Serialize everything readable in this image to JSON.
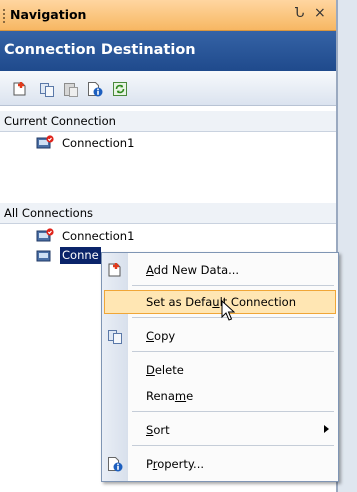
{
  "pane": {
    "title": "Navigation",
    "pin_glyph": "Ն",
    "close_glyph": "×",
    "header": "Connection Destination"
  },
  "toolbar": {
    "icons": [
      "new-connection-icon",
      "copy-icon",
      "paste-icon",
      "property-icon",
      "refresh-icon"
    ]
  },
  "current_section": {
    "label": "Current Connection",
    "items": [
      "Connection1"
    ]
  },
  "all_section": {
    "label": "All Connections",
    "items": [
      "Connection1",
      "Conne"
    ]
  },
  "context_menu": {
    "add_new_data": {
      "pre": "",
      "key": "A",
      "post": "dd New Data..."
    },
    "set_default": {
      "pre": "Set as Defa",
      "key": "u",
      "post": "lt Connection"
    },
    "copy": {
      "pre": "",
      "key": "C",
      "post": "opy"
    },
    "delete": {
      "pre": "",
      "key": "D",
      "post": "elete"
    },
    "rename": {
      "pre": "Rena",
      "key": "m",
      "post": "e"
    },
    "sort": {
      "pre": "",
      "key": "S",
      "post": "ort"
    },
    "property": {
      "pre": "P",
      "key": "r",
      "post": "operty..."
    }
  },
  "colors": {
    "title_bar": "#f7b763",
    "header_blue": "#1f4a8c",
    "menu_highlight": "#ffe6b3",
    "selection": "#0a246a"
  }
}
